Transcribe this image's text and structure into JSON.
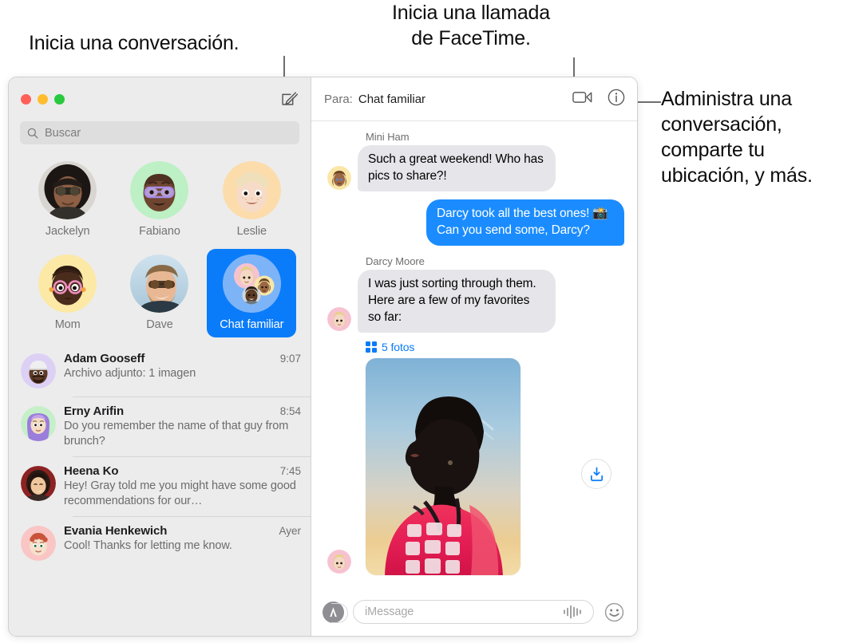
{
  "callouts": {
    "start_conversation": "Inicia una conversación.",
    "facetime": "Inicia una llamada\nde FaceTime.",
    "facetime_line1": "Inicia una llamada",
    "facetime_line2": "de FaceTime.",
    "manage": "Administra una conversación, comparte tu ubicación, y más."
  },
  "sidebar": {
    "search": {
      "placeholder": "Buscar"
    },
    "compose_button_name": "compose-message",
    "pinned": [
      {
        "label": "Jackelyn",
        "selected": false,
        "type": "photo"
      },
      {
        "label": "Fabiano",
        "selected": false,
        "type": "memoji"
      },
      {
        "label": "Leslie",
        "selected": false,
        "type": "memoji"
      },
      {
        "label": "Mom",
        "selected": false,
        "type": "memoji"
      },
      {
        "label": "Dave",
        "selected": false,
        "type": "photo"
      },
      {
        "label": "Chat familiar",
        "selected": true,
        "type": "group"
      }
    ],
    "conversations": [
      {
        "name": "Adam Gooseff",
        "time": "9:07",
        "preview": "Archivo adjunto:  1 imagen"
      },
      {
        "name": "Erny Arifin",
        "time": "8:54",
        "preview": "Do you remember the name of that guy from brunch?"
      },
      {
        "name": "Heena Ko",
        "time": "7:45",
        "preview": "Hey! Gray told me you might have some good recommendations for our…"
      },
      {
        "name": "Evania Henkewich",
        "time": "Ayer",
        "preview": "Cool! Thanks for letting me know."
      }
    ]
  },
  "chat": {
    "to_label": "Para:",
    "to_value": "Chat familiar",
    "facetime_button_name": "facetime-video",
    "info_button_name": "conversation-info",
    "messages": [
      {
        "sender": "Mini Ham",
        "direction": "in",
        "text": "Such a great weekend! Who has pics to share?!"
      },
      {
        "sender": "",
        "direction": "out",
        "text": "Darcy took all the best ones! 📸 Can you send some, Darcy?"
      },
      {
        "sender": "Darcy Moore",
        "direction": "in",
        "text": "I was just sorting through them. Here are a few of my favorites so far:"
      }
    ],
    "attachment": {
      "count_label": "5 fotos",
      "download_button_name": "download-photos"
    },
    "compose": {
      "placeholder": "iMessage",
      "apps_button_name": "apps-store",
      "audio_button_name": "audio-message",
      "emoji_button_name": "emoji-picker"
    }
  },
  "colors": {
    "accent_blue": "#0b7cf9",
    "bubble_out": "#1a8cff",
    "bubble_in": "#e6e5ea",
    "sidebar_bg": "#ececec",
    "traffic_red": "#ff6159",
    "traffic_yellow": "#ffbd2e",
    "traffic_green": "#28c93f"
  }
}
